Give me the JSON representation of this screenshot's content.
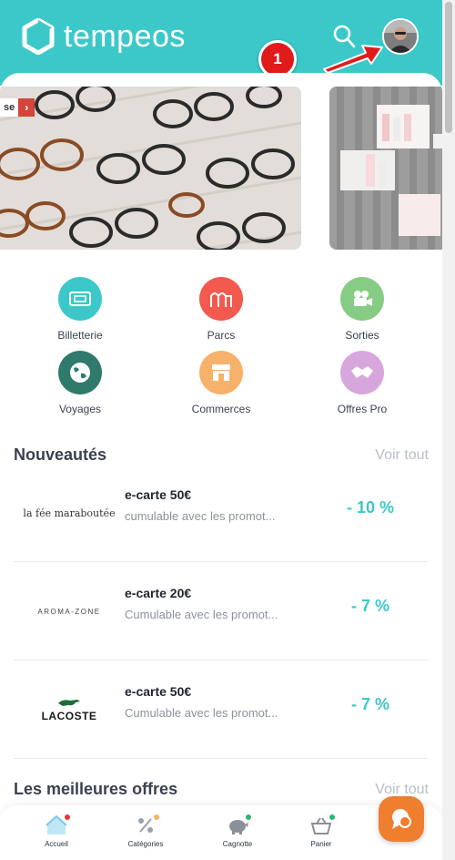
{
  "header": {
    "brand": "tempeos",
    "notification_count": "1",
    "accent_color": "#3cc8c8",
    "search_icon": "search-icon",
    "avatar_icon": "user-avatar"
  },
  "banners": [
    {
      "tag": "se",
      "icon": "glasses-photo"
    },
    {
      "icon": "cosmetics-photo"
    }
  ],
  "categories": [
    {
      "label": "Billetterie",
      "color": "#3cc8c8",
      "icon": "ticket-icon"
    },
    {
      "label": "Parcs",
      "color": "#f25a4f",
      "icon": "park-icon"
    },
    {
      "label": "Sorties",
      "color": "#86cc84",
      "icon": "camera-icon"
    },
    {
      "label": "Voyages",
      "color": "#2f7a6b",
      "icon": "globe-icon"
    },
    {
      "label": "Commerces",
      "color": "#f6b26b",
      "icon": "shop-icon"
    },
    {
      "label": "Offres Pro",
      "color": "#d7a6dc",
      "icon": "handshake-icon"
    }
  ],
  "sections": {
    "new_title": "Nouveautés",
    "new_more": "Voir tout",
    "best_title": "Les meilleures offres",
    "best_more": "Voir tout"
  },
  "offers": [
    {
      "brand": "la fée maraboutée",
      "title": "e-carte 50€",
      "subtitle": "cumulable avec les promot...",
      "discount": "- 10 %"
    },
    {
      "brand": "AROMA-ZONE",
      "title": "e-carte 20€",
      "subtitle": "Cumulable avec les promot...",
      "discount": "- 7 %"
    },
    {
      "brand": "LACOSTE",
      "title": "e-carte 50€",
      "subtitle": "Cumulable avec les promot...",
      "discount": "- 7 %"
    }
  ],
  "bottom_nav": [
    {
      "label": "Accueil",
      "icon": "home-icon",
      "dot": "#e53935"
    },
    {
      "label": "Catégories",
      "icon": "discount-icon",
      "dot": "#f6b26b"
    },
    {
      "label": "Cagnotte",
      "icon": "piggy-bank-icon",
      "dot": "#2bb673"
    },
    {
      "label": "Panier",
      "icon": "basket-icon",
      "dot": "#2bb673"
    }
  ],
  "chat_icon": "chat-icon"
}
